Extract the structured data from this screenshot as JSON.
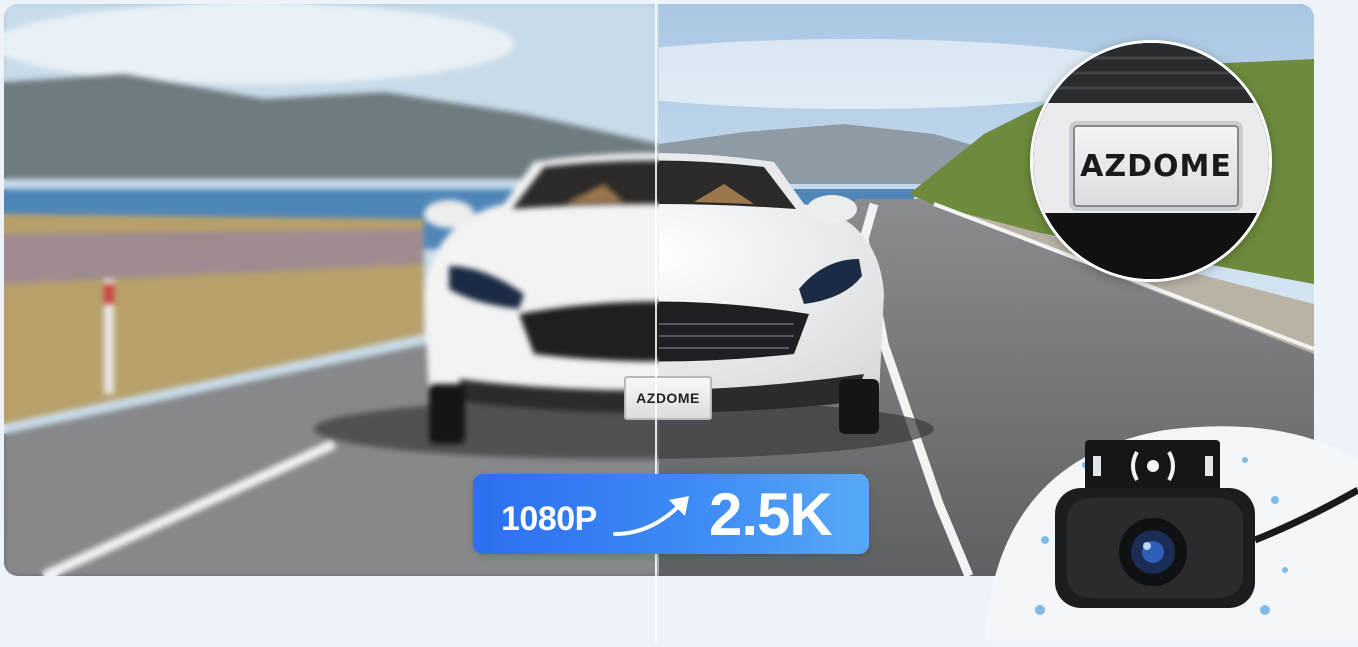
{
  "plate_text": "AZDOME",
  "car_plate_text": "AZDOME",
  "resolution_badge": {
    "from": "1080P",
    "to": "2.5K",
    "gradient_start": "#2c6ff0",
    "gradient_end": "#57a9f7"
  },
  "icons": {
    "arrow": "upgrade-arrow-icon",
    "camera": "rear-camera-icon",
    "signal": "wireless-signal-icon"
  },
  "colors": {
    "sky": "#cfe0ef",
    "road": "#6d6f72",
    "lake": "#4f86b8",
    "car": "#f2f2f0"
  }
}
